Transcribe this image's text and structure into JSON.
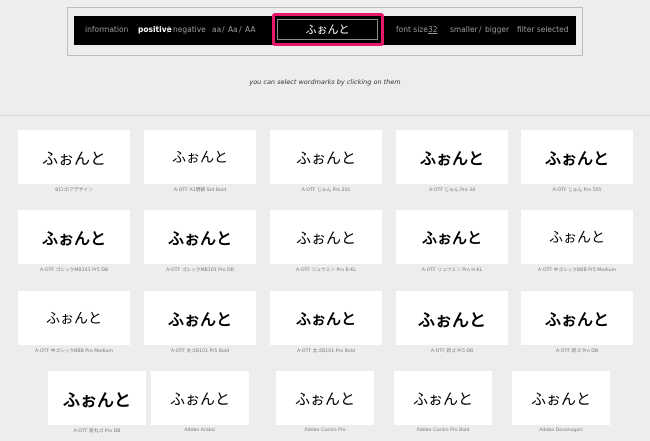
{
  "toolbar": {
    "information": "information",
    "positive": "positive",
    "slash": "/",
    "negative": "negative",
    "case_aa_lower": "aa",
    "case_Aa": "Aa",
    "case_AA": "AA",
    "preview_text": "ふぉんと",
    "font_size_label": "font size",
    "font_size_value": "32",
    "smaller": "smaller",
    "bigger": "bigger",
    "filter_selected": "filter selected"
  },
  "hint": "you can select wordmarks by clicking on them",
  "wordmark": "ふぉんと",
  "fonts": [
    {
      "name": "Bロゴ/アデザイン",
      "weight": "normal",
      "size": 16
    },
    {
      "name": "A-OTF A1明朝 Std Bold",
      "weight": "normal",
      "size": 14
    },
    {
      "name": "A-OTF じゅん Pro 201",
      "weight": "normal",
      "size": 15
    },
    {
      "name": "A-OTF じゅん Pro 34",
      "weight": "bold",
      "size": 16
    },
    {
      "name": "A-OTF じゅん Pro 501",
      "weight": "bold",
      "size": 16
    },
    {
      "name": "A-OTF ゴシックMB101 Pr5 DB",
      "weight": "bold",
      "size": 16
    },
    {
      "name": "A-OTF ゴシックMB101 Pro DB",
      "weight": "bold",
      "size": 16
    },
    {
      "name": "A-OTF リュウミン Pro B-KL",
      "weight": "normal",
      "size": 15
    },
    {
      "name": "A-OTF リュウミン Pro H-KL",
      "weight": "bold",
      "size": 15
    },
    {
      "name": "A-OTF 中ゴシックBBB Pr5 Medium",
      "weight": "normal",
      "size": 14
    },
    {
      "name": "A-OTF 中ゴシックBBB Pro Medium",
      "weight": "normal",
      "size": 14
    },
    {
      "name": "A-OTF 太ゴB101 Pr5 Bold",
      "weight": "bold",
      "size": 16
    },
    {
      "name": "A-OTF 太ゴB101 Pro Bold",
      "weight": "bold",
      "size": 15
    },
    {
      "name": "A-OTF 新ゴ Pr5 DB",
      "weight": "bold",
      "size": 17
    },
    {
      "name": "A-OTF 新ゴ Pro DB",
      "weight": "bold",
      "size": 16
    },
    {
      "name": "A-OTF 新丸ゴ Pro DB",
      "weight": "bold",
      "size": 17
    },
    {
      "name": "Adobe Arabic",
      "weight": "normal",
      "size": 15
    },
    {
      "name": "Adobe Caslon Pro",
      "weight": "normal",
      "size": 15
    },
    {
      "name": "Adobe Caslon Pro Bold",
      "weight": "normal",
      "size": 15
    },
    {
      "name": "Adobe Devanagari",
      "weight": "normal",
      "size": 15
    }
  ]
}
